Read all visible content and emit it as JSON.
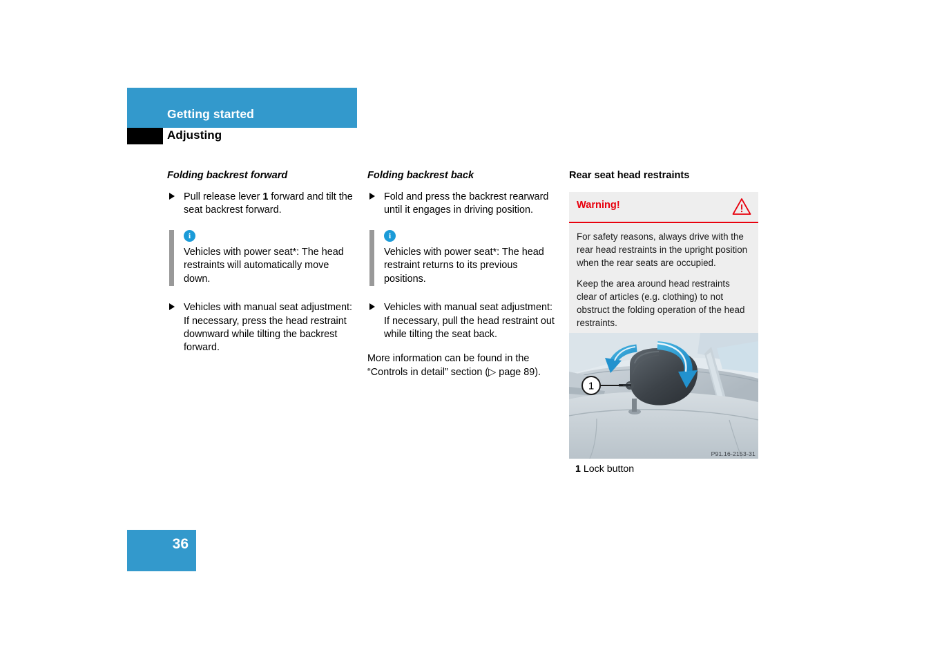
{
  "header": {
    "chapter": "Getting started",
    "section": "Adjusting"
  },
  "columns": {
    "col1": {
      "subhead": "Folding backrest forward",
      "steps": [
        {
          "pre": "Pull release lever ",
          "bold": "1",
          "post": " forward and tilt the seat backrest forward."
        },
        {
          "pre": "",
          "bold": "",
          "post": "Vehicles with manual seat adjustment: If necessary, press the head restraint downward while tilting the backrest forward."
        }
      ],
      "note": {
        "icon": "info-icon",
        "text": "Vehicles with power seat*: The head restraints will automatically move down."
      }
    },
    "col2": {
      "subhead": "Folding backrest back",
      "steps": [
        {
          "pre": "",
          "bold": "",
          "post": "Fold and press the backrest rearward until it engages in driving position."
        },
        {
          "pre": "",
          "bold": "",
          "post": "Vehicles with manual seat adjustment: If necessary, pull the head restraint out while tilting the seat back."
        }
      ],
      "note": {
        "icon": "info-icon",
        "text": "Vehicles with power seat*: The head restraint returns to its previous positions."
      },
      "closing_paragraph": "More information can be found in the “Controls in detail” section (▷ page 89)."
    },
    "col3": {
      "subhead": "Rear seat head restraints",
      "warning": {
        "title": "Warning!",
        "icon": "warning-triangle-icon",
        "paragraphs": [
          "For safety reasons, always drive with the rear head restraints in the upright position when the rear seats are occupied.",
          "Keep the area around head restraints clear of articles (e.g. clothing) to not obstruct the folding operation of the head restraints."
        ]
      },
      "figure": {
        "code": "P91.16-2153-31",
        "callout": "1",
        "caption_number": "1",
        "caption_text": "Lock button"
      }
    }
  },
  "footer": {
    "page_number": "36"
  },
  "colors": {
    "brand_blue": "#3399CC",
    "info_blue": "#1B9BD8",
    "warning_red": "#E8000D",
    "note_rule_gray": "#999999",
    "warning_bg": "#EEEEEE"
  }
}
